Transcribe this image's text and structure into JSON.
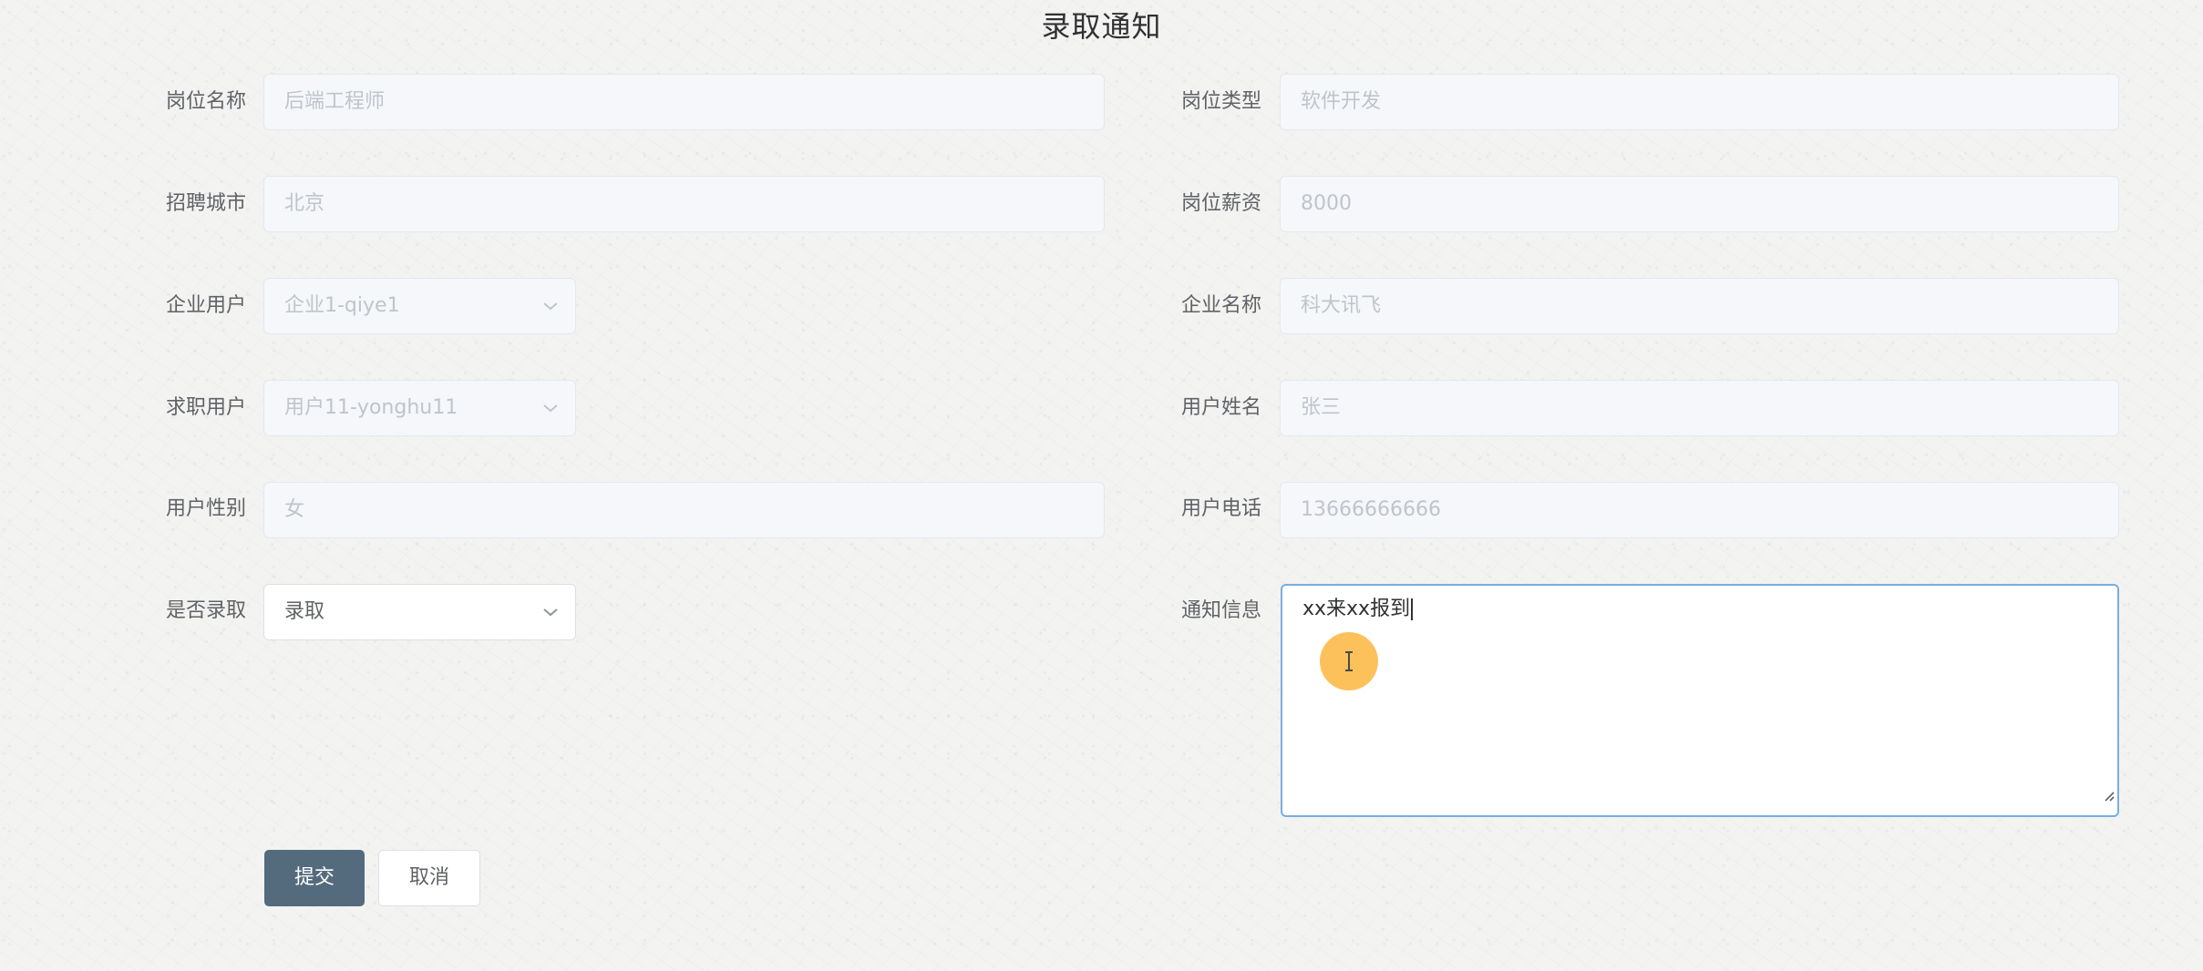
{
  "page": {
    "title": "录取通知"
  },
  "form": {
    "job_name": {
      "label": "岗位名称",
      "value": "后端工程师"
    },
    "job_type": {
      "label": "岗位类型",
      "value": "软件开发"
    },
    "city": {
      "label": "招聘城市",
      "value": "北京"
    },
    "salary": {
      "label": "岗位薪资",
      "value": "8000"
    },
    "company_user": {
      "label": "企业用户",
      "value": "企业1-qiye1"
    },
    "company_name": {
      "label": "企业名称",
      "value": "科大讯飞"
    },
    "job_seeker": {
      "label": "求职用户",
      "value": "用户11-yonghu11"
    },
    "user_name": {
      "label": "用户姓名",
      "value": "张三"
    },
    "gender": {
      "label": "用户性别",
      "value": "女"
    },
    "phone": {
      "label": "用户电话",
      "value": "13666666666"
    },
    "admitted": {
      "label": "是否录取",
      "value": "录取"
    },
    "notice": {
      "label": "通知信息",
      "value": "xx来xx报到"
    }
  },
  "actions": {
    "submit_label": "提交",
    "cancel_label": "取消"
  },
  "colors": {
    "primary_button": "#546b7d",
    "focus_border": "#78aee0",
    "cursor_highlight": "#fcb337"
  },
  "icons": {
    "select_arrow": "chevron-down-icon",
    "text_cursor": "i-beam-cursor-icon",
    "resize_handle": "resize-handle-icon"
  }
}
